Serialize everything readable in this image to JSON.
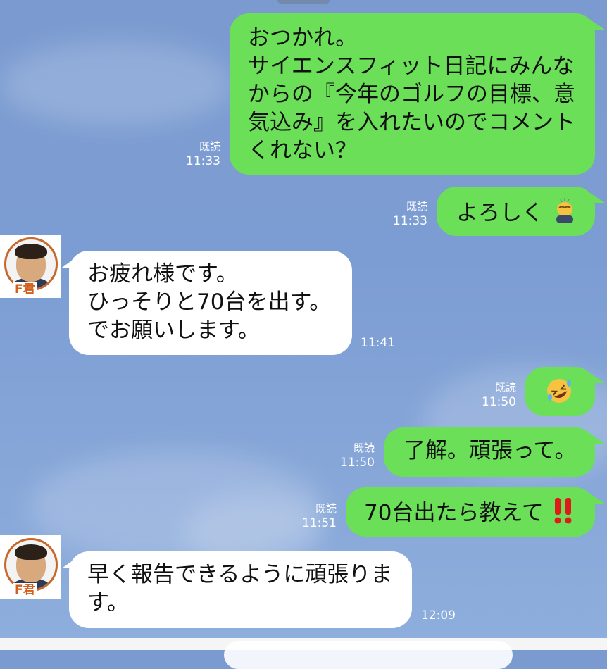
{
  "messages": [
    {
      "id": "m1",
      "side": "sent",
      "lines": [
        "おつかれ。",
        "サイエンスフィット日記にみんな",
        "からの『今年のゴルフの目標、意",
        "気込み』を入れたいのでコメント",
        "くれない？"
      ],
      "read": "既読",
      "time": "11:33"
    },
    {
      "id": "m2",
      "side": "sent",
      "text": "よろしく",
      "emoji": "bowing-person-emoji",
      "read": "既読",
      "time": "11:33"
    },
    {
      "id": "m3",
      "side": "received",
      "sender": "F君",
      "lines": [
        "お疲れ様です。",
        "ひっそりと70台を出す。",
        "でお願いします。"
      ],
      "time": "11:41"
    },
    {
      "id": "m4",
      "side": "sent",
      "emoji": "rolling-on-floor-laughing-emoji",
      "read": "既読",
      "time": "11:50"
    },
    {
      "id": "m5",
      "side": "sent",
      "text": "了解。頑張って。",
      "read": "既読",
      "time": "11:50"
    },
    {
      "id": "m6",
      "side": "sent",
      "text": "70台出たら教えて",
      "emoji": "double-exclamation-emoji",
      "read": "既読",
      "time": "11:51"
    },
    {
      "id": "m7",
      "side": "received",
      "sender": "F君",
      "lines": [
        "早く報告できるように頑張りま",
        "す。"
      ],
      "time": "12:09"
    }
  ],
  "colors": {
    "sent_bubble": "#6bdf57",
    "received_bubble": "#ffffff",
    "background": "#7c9dd3",
    "avatar_ring": "#c6682b",
    "avatar_label": "#d2601c",
    "exclamation": "#e01a1a"
  }
}
